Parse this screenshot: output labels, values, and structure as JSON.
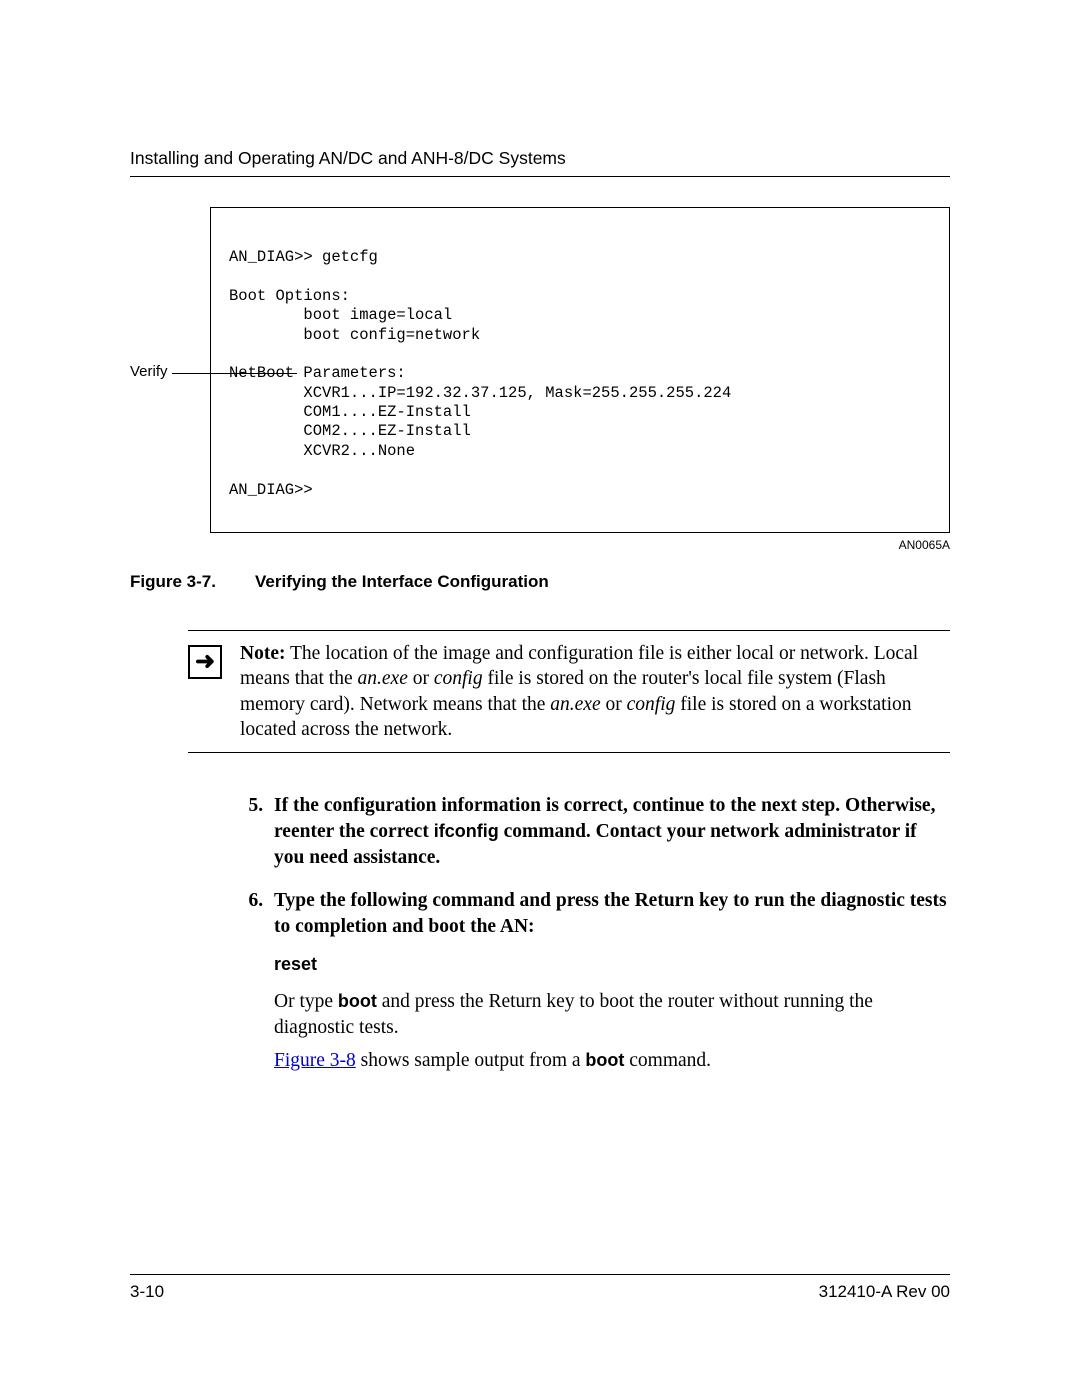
{
  "header": {
    "title": "Installing and Operating AN/DC and ANH-8/DC Systems"
  },
  "figure": {
    "verify_label": "Verify",
    "code": "AN_DIAG>> getcfg\n\nBoot Options:\n        boot image=local\n        boot config=network\n\nNetBoot Parameters:\n        XCVR1...IP=192.32.37.125, Mask=255.255.255.224\n        COM1....EZ-Install\n        COM2....EZ-Install\n        XCVR2...None\n\nAN_DIAG>>",
    "image_id": "AN0065A",
    "caption_num": "Figure 3-7.",
    "caption_text": "Verifying the Interface Configuration"
  },
  "note": {
    "label": "Note:",
    "t1": " The location of the image and configuration file is either local or network. Local means that the ",
    "i1": "an.exe",
    "t2": " or ",
    "i2": "config",
    "t3": " file is stored on the router's local file system (Flash memory card). Network means that the ",
    "i3": "an.exe",
    "t4": " or ",
    "i4": "config",
    "t5": " file is stored on a workstation located across the network."
  },
  "steps": {
    "s5a": "If the configuration information is correct, continue to the next step. Otherwise, reenter the correct ",
    "s5b": "ifconfig",
    "s5c": " command. Contact your network administrator if you need assistance.",
    "s6a": "Type the following command and press the Return key to run the diagnostic tests to completion and boot the AN:",
    "s6cmd": "reset",
    "s6p1a": "Or type ",
    "s6p1b": "boot",
    "s6p1c": " and press the Return key to boot the router without running the diagnostic tests.",
    "s6p2a": "Figure 3-8",
    "s6p2b": " shows sample output from a ",
    "s6p2c": "boot",
    "s6p2d": " command."
  },
  "footer": {
    "page": "3-10",
    "doc": "312410-A Rev 00"
  }
}
